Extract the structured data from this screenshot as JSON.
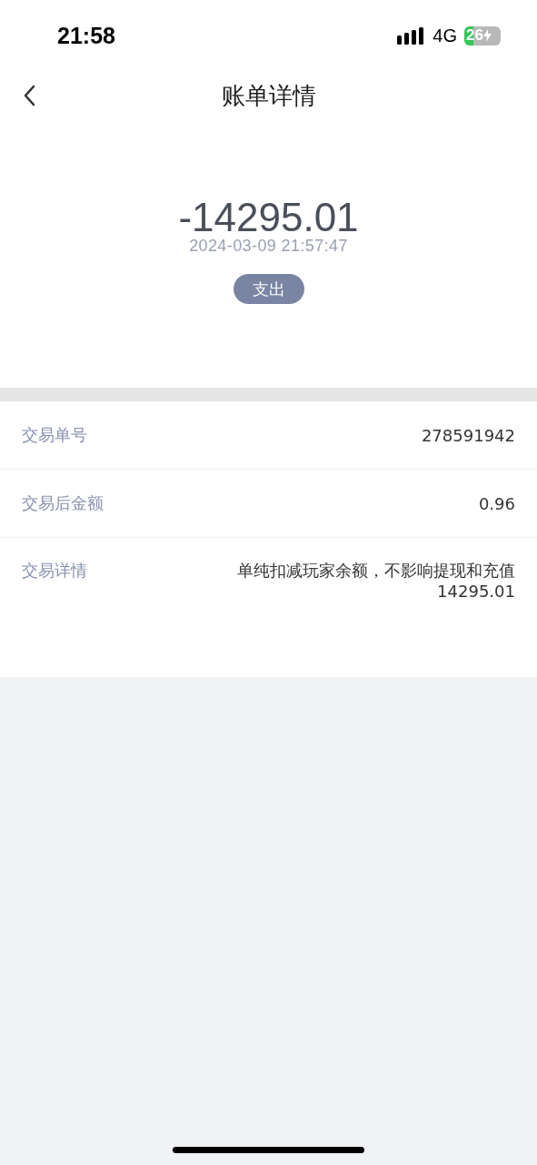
{
  "status_bar": {
    "time": "21:58",
    "network": "4G",
    "battery": "26",
    "charging": true
  },
  "nav": {
    "title": "账单详情"
  },
  "summary": {
    "amount": "-14295.01",
    "datetime": "2024-03-09 21:57:47",
    "type_badge": "支出"
  },
  "details": [
    {
      "label": "交易单号",
      "lines": [
        "278591942"
      ]
    },
    {
      "label": "交易后金额",
      "lines": [
        "0.96"
      ]
    },
    {
      "label": "交易详情",
      "lines": [
        "单纯扣减玩家余额，不影响提现和充值",
        "14295.01"
      ]
    }
  ]
}
